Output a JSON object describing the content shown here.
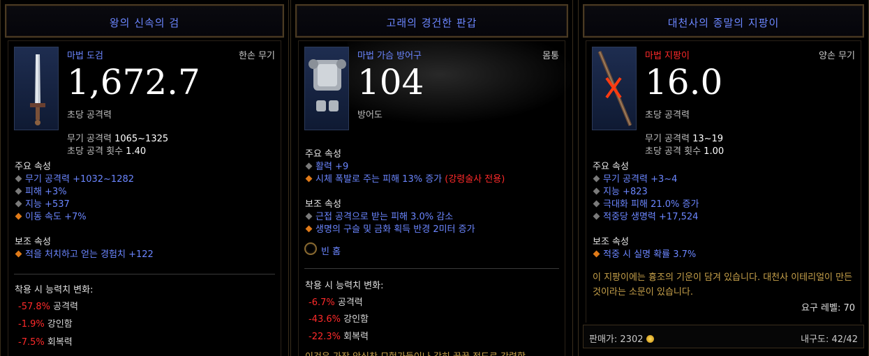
{
  "panels": [
    {
      "title": "왕의 신속의 검",
      "item_type": "마법 도검",
      "slot": "한손 무기",
      "main_value": "1,672.7",
      "main_caption": "초당 공격력",
      "weapon_damage_label": "무기 공격력",
      "weapon_damage": "1065~1325",
      "attack_speed_label": "초당 공격 횟수",
      "attack_speed": "1.40",
      "primary_header": "주요 속성",
      "primary": [
        "무기 공격력 +1032~1282",
        "피해 +3%",
        "지능 +537",
        "이동 속도 +7%"
      ],
      "secondary_header": "보조 속성",
      "secondary": [
        "적을 처치하고 얻는 경험치 +122"
      ],
      "changes_header": "착용 시 능력치 변화:",
      "changes": [
        {
          "value": "-57.8%",
          "label": "공격력"
        },
        {
          "value": "-1.9%",
          "label": "강인함"
        },
        {
          "value": "-7.5%",
          "label": "회복력"
        }
      ],
      "icon": "sword-icon"
    },
    {
      "title": "고래의 경건한 판갑",
      "item_type": "마법 가슴 방어구",
      "slot": "몸통",
      "main_value": "104",
      "main_caption": "방어도",
      "primary_header": "주요 속성",
      "primary_1": "활력 +9",
      "primary_2": "시체 폭발로 주는 피해 13% 증가",
      "primary_2_note": "(강령술사 전용)",
      "secondary_header": "보조 속성",
      "secondary": [
        "근접 공격으로 받는 피해 3.0% 감소",
        "생명의 구슬 및 금화 획득 반경 2미터 증가"
      ],
      "socket": "빈 홈",
      "changes_header": "착용 시 능력치 변화:",
      "changes": [
        {
          "value": "-6.7%",
          "label": "공격력"
        },
        {
          "value": "-43.6%",
          "label": "강인함"
        },
        {
          "value": "-22.3%",
          "label": "회복력"
        }
      ],
      "cut_text": "이것은 가장 악식찬 모험가들이나 감히 꿈꿀 정도로 강력합",
      "icon": "chest-armor-icon"
    },
    {
      "title": "대천사의 종말의 지팡이",
      "item_type": "마법 지팡이",
      "slot": "양손 무기",
      "main_value": "16.0",
      "main_caption": "초당 공격력",
      "weapon_damage_label": "무기 공격력",
      "weapon_damage": "13~19",
      "attack_speed_label": "초당 공격 횟수",
      "attack_speed": "1.00",
      "primary_header": "주요 속성",
      "primary": [
        "무기 공격력 +3~4",
        "지능 +823",
        "극대화 피해 21.0% 증가",
        "적중당 생명력 +17,524"
      ],
      "secondary_header": "보조 속성",
      "secondary": [
        "적중 시 실명 확률 3.7%"
      ],
      "flavor": "이 지팡이에는 흉조의 기운이 담겨 있습니다. 대천사 이테리얼이 만든 것이라는 소문이 있습니다.",
      "required_level": "요구 레벨: 70",
      "sell_label": "판매가:",
      "sell_value": "2302",
      "durability_label": "내구도:",
      "durability_value": "42/42",
      "icon": "staff-icon"
    }
  ],
  "colors": {
    "magic_blue": "#6b86ff",
    "negative_red": "#ff2a2a",
    "flavor_gold": "#c7a14a",
    "legendary_orange": "#e07a18"
  }
}
